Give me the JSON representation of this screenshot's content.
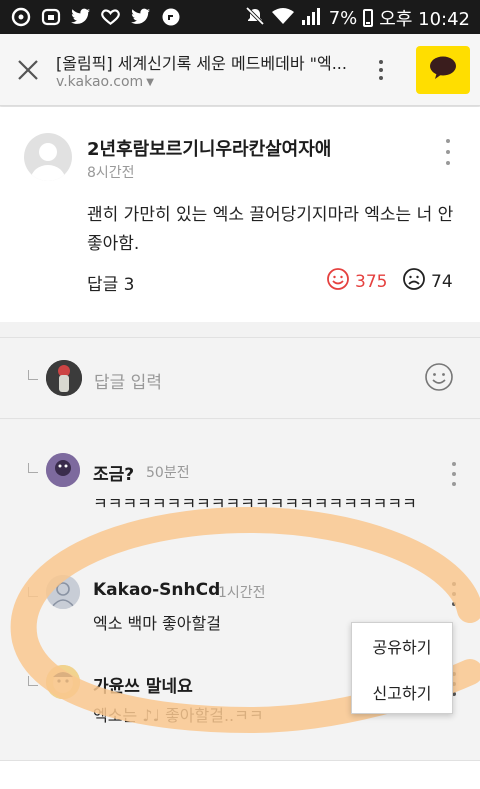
{
  "status_bar": {
    "battery": "7%",
    "time": "오후 10:42"
  },
  "toolbar": {
    "title": "[올림픽] 세계신기록 세운 메드베데바 \"엑...",
    "url": "v.kakao.com"
  },
  "comment": {
    "author": "2년후람보르기니우라칸살여자애",
    "time": "8시간전",
    "body": "괜히 가만히 있는 엑소 끌어당기지마라 엑소는 너 안좋아함.",
    "replies_label": "답글 3",
    "likes": "375",
    "dislikes": "74"
  },
  "reply_input": {
    "placeholder": "답글 입력"
  },
  "replies": [
    {
      "author": "조금?",
      "time": "50분전",
      "text": "ㅋㅋㅋㅋㅋㅋㅋㅋㅋㅋㅋㅋㅋㅋㅋㅋㅋㅋㅋㅋㅋㅋ"
    },
    {
      "author": "Kakao-SnhCd",
      "time": "1시간전",
      "text": "엑소 백마 좋아할걸"
    },
    {
      "author": "가윤쓰 말네요",
      "time": "",
      "text": "엑소는 ♪♩ 좋아할걸..ㅋㅋ"
    }
  ],
  "context_menu": {
    "share": "공유하기",
    "report": "신고하기"
  },
  "colors": {
    "kakao_yellow": "#ffde00",
    "like_red": "#e5413f",
    "highlight_orange": "#f9c78e"
  },
  "icons": [
    "close-icon",
    "more-vert-icon",
    "kakao-talk-icon",
    "smile-icon",
    "frown-icon",
    "emoji-icon"
  ]
}
